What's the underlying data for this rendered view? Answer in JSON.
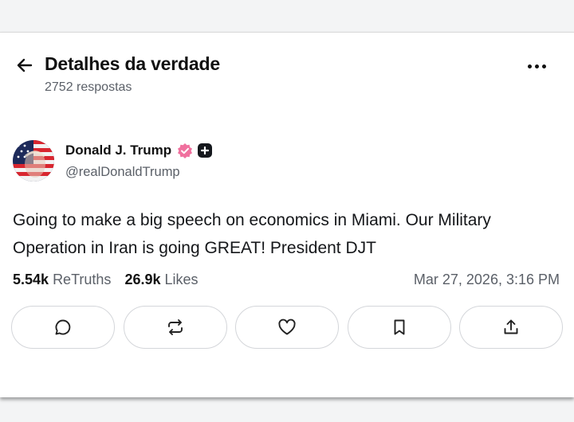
{
  "header": {
    "title": "Detalhes da verdade",
    "replies": "2752 respostas"
  },
  "post": {
    "author_name": "Donald J. Trump",
    "handle": "@realDonaldTrump",
    "text": "Going to make a big speech on economics in Miami. Our Military Operation in Iran is going GREAT! President DJT",
    "retruths_count": "5.54k",
    "retruths_label": "ReTruths",
    "likes_count": "26.9k",
    "likes_label": "Likes",
    "timestamp": "Mar 27, 2026, 3:16 PM"
  },
  "actions": [
    {
      "icon": "comment-icon"
    },
    {
      "icon": "retruth-icon"
    },
    {
      "icon": "heart-icon"
    },
    {
      "icon": "bookmark-icon"
    },
    {
      "icon": "share-icon"
    }
  ],
  "colors": {
    "verified_badge": "#f0709e",
    "text_primary": "#111111",
    "text_secondary": "#5b6068",
    "button_border": "#d4d6da"
  }
}
